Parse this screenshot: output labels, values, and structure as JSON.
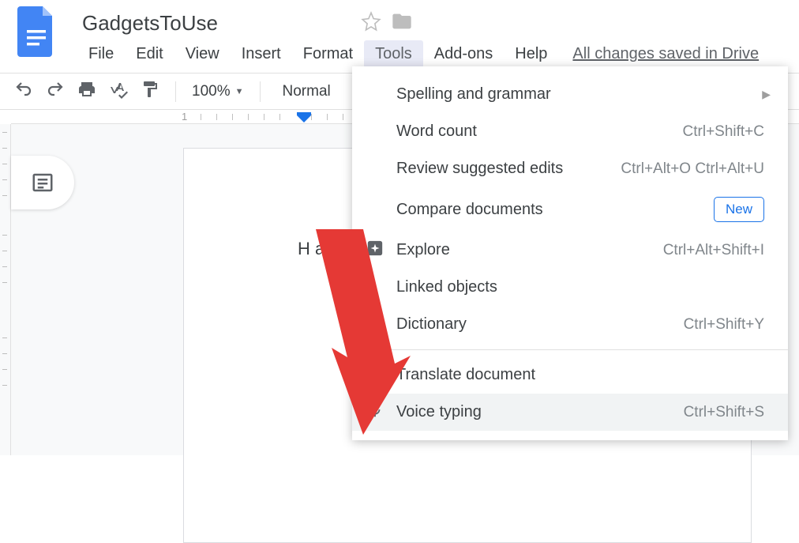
{
  "header": {
    "title": "GadgetsToUse",
    "menu": [
      "File",
      "Edit",
      "View",
      "Insert",
      "Format",
      "Tools",
      "Add-ons",
      "Help"
    ],
    "active_menu_index": 5,
    "save_status": "All changes saved in Drive"
  },
  "toolbar": {
    "zoom": "100%",
    "paragraph_style": "Normal"
  },
  "ruler": {
    "label1": "1"
  },
  "document": {
    "content": "H  a .."
  },
  "tools_menu": {
    "items": [
      {
        "label": "Spelling and grammar",
        "shortcut": "",
        "submenu": true,
        "icon": null
      },
      {
        "label": "Word count",
        "shortcut": "Ctrl+Shift+C",
        "icon": null
      },
      {
        "label": "Review suggested edits",
        "shortcut": "Ctrl+Alt+O Ctrl+Alt+U",
        "icon": null
      },
      {
        "label": "Compare documents",
        "shortcut": "",
        "badge": "New",
        "icon": null
      },
      {
        "label": "Explore",
        "shortcut": "Ctrl+Alt+Shift+I",
        "icon": "explore"
      },
      {
        "label": "Linked objects",
        "shortcut": "",
        "icon": null
      },
      {
        "label": "Dictionary",
        "shortcut": "Ctrl+Shift+Y",
        "icon": null
      }
    ],
    "items2": [
      {
        "label": "Translate document",
        "shortcut": "",
        "icon": null
      },
      {
        "label": "Voice typing",
        "shortcut": "Ctrl+Shift+S",
        "icon": "mic",
        "hover": true
      }
    ]
  }
}
